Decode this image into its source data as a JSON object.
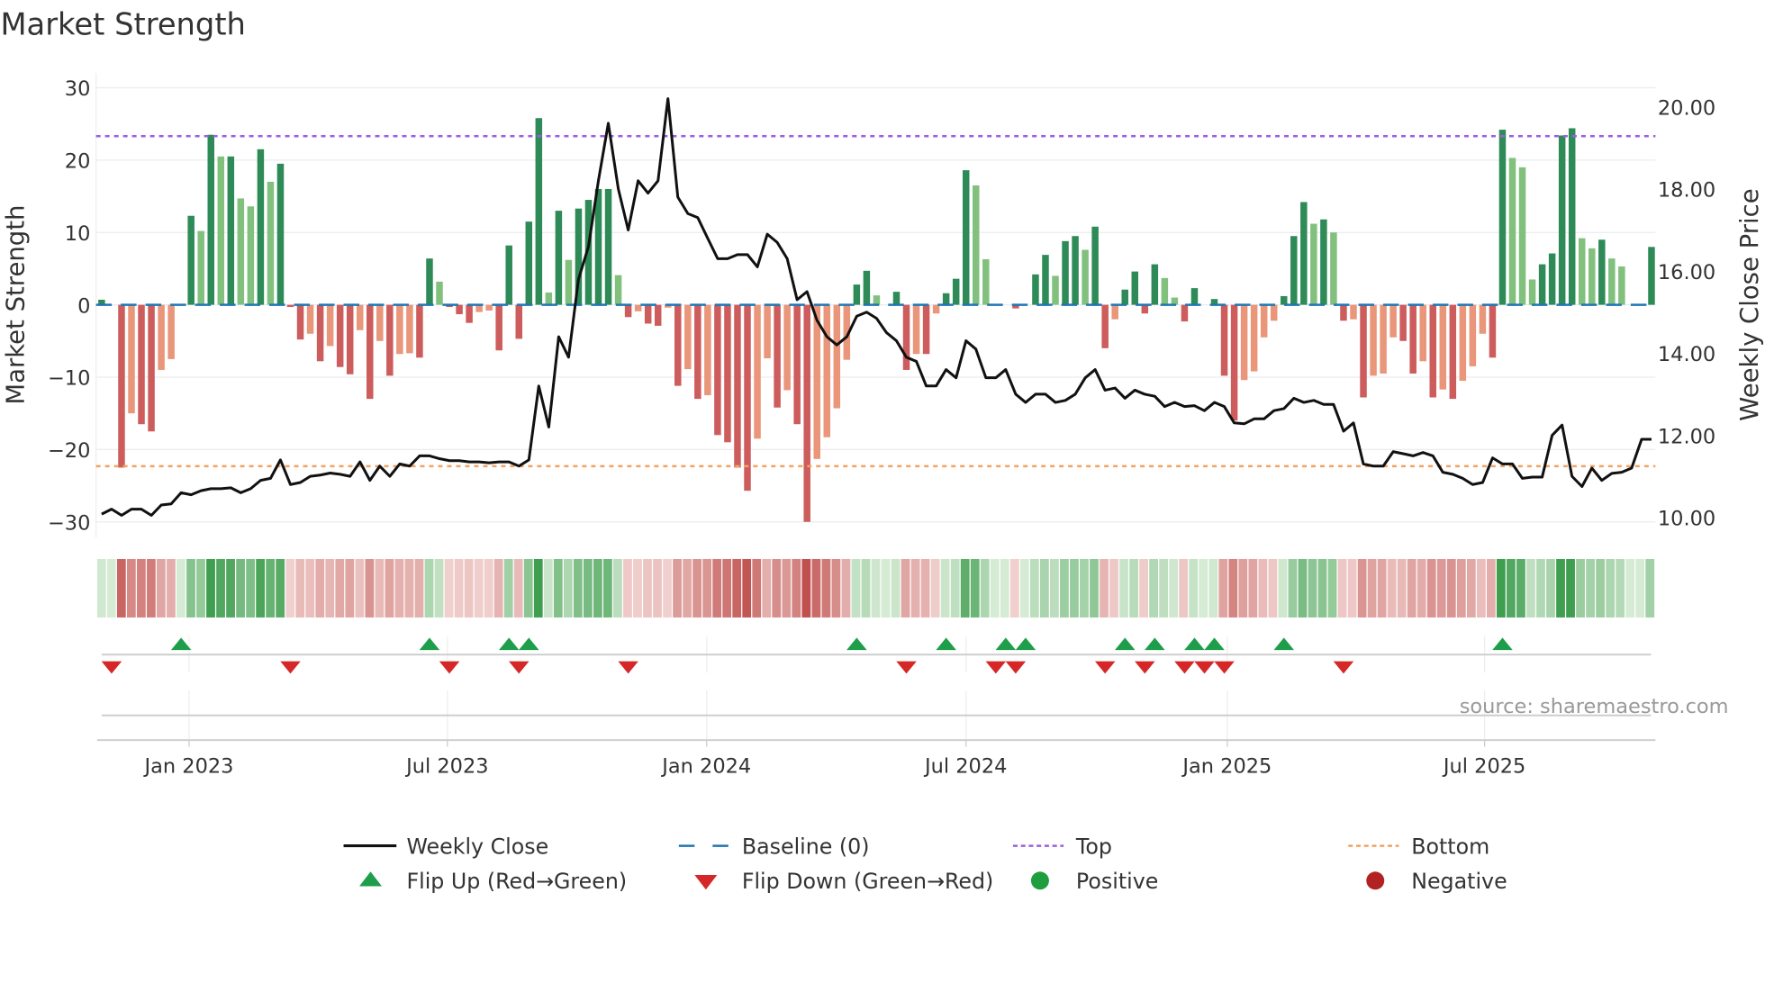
{
  "chart_data": {
    "type": "bar",
    "title": "Market Strength",
    "ylabel": "Market Strength",
    "y2label": "Weekly Close Price",
    "ylim": [
      -30,
      30
    ],
    "y2lim": [
      10,
      20
    ],
    "yticks": [
      "30",
      "20",
      "10",
      "0",
      "−10",
      "−20",
      "−30"
    ],
    "ytick_values": [
      30,
      20,
      10,
      0,
      -10,
      -20,
      -30
    ],
    "y2ticks": [
      "20.00",
      "18.00",
      "16.00",
      "14.00",
      "12.00",
      "10.00"
    ],
    "y2tick_values": [
      20,
      18,
      16,
      14,
      12,
      10
    ],
    "xticks": [
      {
        "label": "Jan 2023",
        "week": 8.8
      },
      {
        "label": "Jul 2023",
        "week": 34.8
      },
      {
        "label": "Jan 2024",
        "week": 60.9
      },
      {
        "label": "Jul 2024",
        "week": 87.0
      },
      {
        "label": "Jan 2025",
        "week": 113.3
      },
      {
        "label": "Jul 2025",
        "week": 139.2
      }
    ],
    "top_level": 23.3,
    "bottom_level": -22.3,
    "baseline": 0,
    "strength": [
      0.7,
      0,
      -22.5,
      -15,
      -16.5,
      -17.5,
      -9,
      -7.5,
      0,
      12.3,
      10.2,
      23.5,
      20.5,
      20.5,
      14.7,
      13.6,
      21.5,
      17,
      19.5,
      -0.3,
      -4.8,
      -4,
      -7.8,
      -5.7,
      -8.6,
      -9.6,
      -3.5,
      -13,
      -5,
      -9.8,
      -6.8,
      -6.7,
      -7.3,
      6.4,
      3.2,
      -0.3,
      -1.3,
      -2.5,
      -1,
      -0.8,
      -6.3,
      8.2,
      -4.7,
      11.5,
      25.8,
      1.7,
      13,
      6.2,
      13.3,
      14.5,
      16,
      16,
      4.1,
      -1.7,
      -0.9,
      -2.6,
      -2.9,
      -0.4,
      -11.2,
      -8.9,
      -13,
      -12.5,
      -18,
      -19,
      -22.5,
      -25.7,
      -18.5,
      -7.4,
      -14.2,
      -11.8,
      -16.5,
      -30,
      -21.3,
      -18.3,
      -14.3,
      -7.6,
      2.8,
      4.7,
      1.3,
      0,
      1.8,
      -9,
      -6.8,
      -6.8,
      -1.2,
      1.6,
      3.6,
      18.6,
      16.5,
      6.3,
      0,
      0,
      -0.5,
      0,
      4.2,
      6.9,
      4,
      8.8,
      9.5,
      7.6,
      10.8,
      -6,
      -2,
      2.1,
      4.6,
      -1.2,
      5.6,
      3.7,
      1,
      -2.3,
      2.3,
      0,
      0.8,
      -9.8,
      -16,
      -10.4,
      -9.2,
      -4.5,
      -2.2,
      1.2,
      9.5,
      14.2,
      11.2,
      11.8,
      10,
      -2.2,
      -2,
      -12.8,
      -9.8,
      -9.5,
      -4.5,
      -5,
      -9.5,
      -7.8,
      -12.8,
      -11.7,
      -13,
      -10.5,
      -8.5,
      -4,
      -7.3,
      24.2,
      20.3,
      19,
      3.5,
      5.6,
      7.1,
      23.4,
      24.4,
      9.2,
      7.8,
      9,
      6.4,
      5.3,
      0,
      0,
      8
    ],
    "weekly_close": [
      10.08,
      10.2,
      10.05,
      10.2,
      10.2,
      10.05,
      10.3,
      10.33,
      10.6,
      10.55,
      10.65,
      10.7,
      10.7,
      10.72,
      10.6,
      10.7,
      10.9,
      10.95,
      11.4,
      10.8,
      10.85,
      11.0,
      11.03,
      11.08,
      11.05,
      11.0,
      11.35,
      10.9,
      11.25,
      11.0,
      11.3,
      11.25,
      11.5,
      11.5,
      11.43,
      11.38,
      11.38,
      11.35,
      11.35,
      11.33,
      11.35,
      11.35,
      11.25,
      11.4,
      13.2,
      12.2,
      14.4,
      13.9,
      15.8,
      16.6,
      18.2,
      19.6,
      18.0,
      17.0,
      18.2,
      17.9,
      18.2,
      20.2,
      17.8,
      17.4,
      17.3,
      16.8,
      16.3,
      16.3,
      16.4,
      16.4,
      16.1,
      16.9,
      16.7,
      16.3,
      15.3,
      15.5,
      14.8,
      14.4,
      14.2,
      14.4,
      14.9,
      15.0,
      14.85,
      14.5,
      14.3,
      13.9,
      13.8,
      13.2,
      13.2,
      13.6,
      13.4,
      14.3,
      14.1,
      13.4,
      13.4,
      13.6,
      13.0,
      12.8,
      13.0,
      13.0,
      12.8,
      12.85,
      13.0,
      13.4,
      13.6,
      13.1,
      13.15,
      12.9,
      13.1,
      13.0,
      12.95,
      12.7,
      12.8,
      12.7,
      12.72,
      12.6,
      12.8,
      12.7,
      12.3,
      12.28,
      12.4,
      12.4,
      12.6,
      12.65,
      12.9,
      12.8,
      12.85,
      12.75,
      12.75,
      12.1,
      12.3,
      11.3,
      11.25,
      11.25,
      11.6,
      11.55,
      11.5,
      11.58,
      11.5,
      11.1,
      11.05,
      10.95,
      10.8,
      10.85,
      11.45,
      11.3,
      11.3,
      10.95,
      10.98,
      10.98,
      12.0,
      12.25,
      11.0,
      10.75,
      11.2,
      10.9,
      11.07,
      11.1,
      11.2,
      11.9,
      11.9
    ],
    "flip_up_weeks": [
      8,
      33,
      41,
      43,
      76,
      85,
      91,
      93,
      103,
      106,
      110,
      112,
      119,
      141
    ],
    "flip_down_weeks": [
      1,
      19,
      35,
      42,
      53,
      81,
      90,
      92,
      101,
      105,
      109,
      111,
      113,
      125
    ],
    "legend": [
      {
        "label": "Weekly Close",
        "kind": "line",
        "color": "#111111"
      },
      {
        "label": "Baseline (0)",
        "kind": "dash",
        "color": "#1f77b4"
      },
      {
        "label": "Top",
        "kind": "dot",
        "color": "#9b5fe0"
      },
      {
        "label": "Bottom",
        "kind": "dot",
        "color": "#f4a261"
      },
      {
        "label": "Flip Up (Red→Green)",
        "kind": "up",
        "color": "#1e9e4a"
      },
      {
        "label": "Flip Down (Green→Red)",
        "kind": "down",
        "color": "#d62728"
      },
      {
        "label": "Positive",
        "kind": "circle",
        "color": "#1e9e3e"
      },
      {
        "label": "Negative",
        "kind": "circle",
        "color": "#b22222"
      }
    ],
    "legend_placement": "bottom"
  },
  "colors": {
    "pos_strong": "#2e8b57",
    "pos_weak": "#82c07e",
    "neg_strong": "#cd5c5c",
    "neg_weak": "#e9967a",
    "top": "#9b5fe0",
    "bottom": "#f4a261",
    "baseline": "#1f77b4"
  },
  "source": "source: sharemaestro.com"
}
